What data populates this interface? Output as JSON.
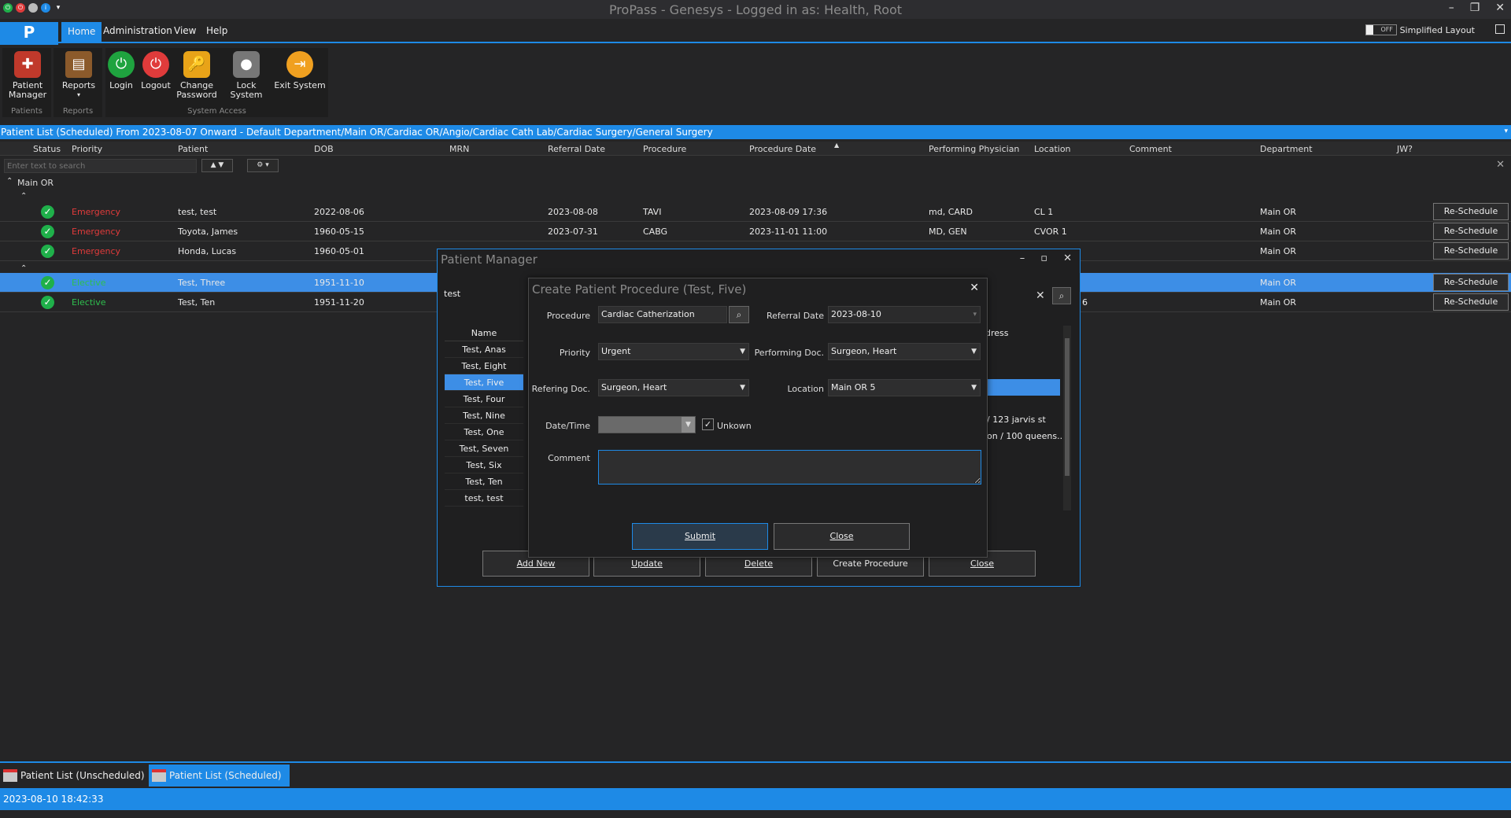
{
  "window": {
    "title": "ProPass - Genesys - Logged in as: Health, Root",
    "simplified_layout": "Simplified Layout",
    "toggle_state": "OFF"
  },
  "logo": "P",
  "menu": [
    "Home",
    "Administration",
    "View",
    "Help"
  ],
  "ribbon": {
    "groups": [
      {
        "label": "Patients",
        "buttons": [
          {
            "label": "Patient Manager",
            "icon": "nurse-icon"
          }
        ]
      },
      {
        "label": "Reports",
        "buttons": [
          {
            "label": "Reports",
            "icon": "book-icon"
          }
        ]
      },
      {
        "label": "System Access",
        "buttons": [
          {
            "label": "Login",
            "icon": "power-on-icon"
          },
          {
            "label": "Logout",
            "icon": "power-off-icon"
          },
          {
            "label": "Change Password",
            "icon": "padlock-key-icon"
          },
          {
            "label": "Lock System",
            "icon": "lock-icon"
          },
          {
            "label": "Exit System",
            "icon": "exit-icon"
          }
        ]
      }
    ]
  },
  "list": {
    "title": "Patient List (Scheduled) From 2023-08-07 Onward - Default Department/Main OR/Cardiac OR/Angio/Cardiac Cath Lab/Cardiac Surgery/General Surgery",
    "columns": [
      "Status",
      "Priority",
      "Patient",
      "DOB",
      "MRN",
      "Referral Date",
      "Procedure",
      "Procedure Date",
      "Performing Physician",
      "Location",
      "Comment",
      "Department",
      "JW?"
    ],
    "search_placeholder": "Enter text to search",
    "group_label": "Main OR",
    "reschedule_label": "Re-Schedule",
    "group1": [
      {
        "priority": "Emergency",
        "patient": "test, test",
        "dob": "2022-08-06",
        "referral": "2023-08-08",
        "procedure": "TAVI",
        "proc_date": "2023-08-09 17:36",
        "physician": "md, CARD",
        "location": "CL 1",
        "department": "Main OR"
      },
      {
        "priority": "Emergency",
        "patient": "Toyota, James",
        "dob": "1960-05-15",
        "referral": "2023-07-31",
        "procedure": "CABG",
        "proc_date": "2023-11-01 11:00",
        "physician": "MD, GEN",
        "location": "CVOR 1",
        "department": "Main OR"
      },
      {
        "priority": "Emergency",
        "patient": "Honda, Lucas",
        "dob": "1960-05-01",
        "referral": "",
        "procedure": "",
        "proc_date": "",
        "physician": "",
        "location": "",
        "department": "Main OR"
      }
    ],
    "group2": [
      {
        "priority": "Elective",
        "patient": "Test, Three",
        "dob": "1951-11-10",
        "department": "Main OR"
      },
      {
        "priority": "Elective",
        "patient": "Test, Ten",
        "dob": "1951-11-20",
        "department": "Main OR"
      }
    ]
  },
  "patient_manager": {
    "title": "Patient Manager",
    "search_value": "test",
    "name_header": "Name",
    "address_header": "dress",
    "names": [
      "Test, Anas",
      "Test, Eight",
      "Test, Five",
      "Test, Four",
      "Test, Nine",
      "Test, One",
      "Test, Seven",
      "Test, Six",
      "Test, Ten",
      "test, test"
    ],
    "addr_nine": "/ 123 jarvis st",
    "addr_one": "on / 100 queens...",
    "side_number": "6",
    "buttons": {
      "add_new": "Add New",
      "update": "Update",
      "delete": "Delete",
      "create_procedure": "Create Procedure",
      "close": "Close"
    }
  },
  "create_procedure": {
    "title": "Create Patient Procedure (Test, Five)",
    "procedure_label": "Procedure",
    "procedure_value": "Cardiac Catherization",
    "referral_date_label": "Referral Date",
    "referral_date_value": "2023-08-10",
    "priority_label": "Priority",
    "priority_value": "Urgent",
    "performing_doc_label": "Performing Doc.",
    "performing_doc_value": "Surgeon, Heart",
    "refering_doc_label": "Refering Doc.",
    "refering_doc_value": "Surgeon, Heart",
    "location_label": "Location",
    "location_value": "Main OR 5",
    "datetime_label": "Date/Time",
    "unknown_label": "Unkown",
    "unknown_checked": true,
    "comment_label": "Comment",
    "submit": "Submit",
    "close": "Close"
  },
  "tabs": [
    "Patient List (Unscheduled)",
    "Patient List (Scheduled)"
  ],
  "status_time": "2023-08-10 18:42:33",
  "colors": {
    "accent": "#1e8ae6",
    "emergency": "#e03b3b",
    "elective": "#2fbf4f",
    "selection": "#3d8ee6"
  }
}
